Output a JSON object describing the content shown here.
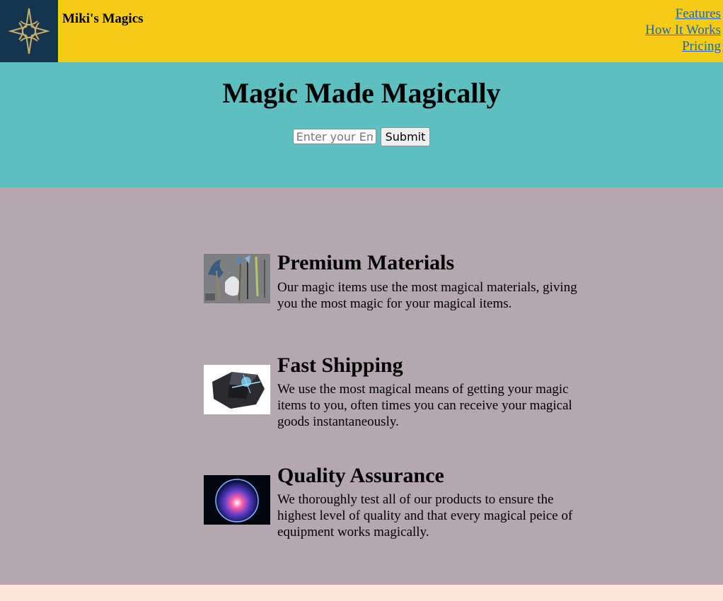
{
  "header": {
    "brand": "Miki's Magics",
    "nav": [
      "Features",
      "How It Works",
      "Pricing"
    ]
  },
  "hero": {
    "title": "Magic Made Magically",
    "email_placeholder": "Enter your Email",
    "submit_label": "Submit"
  },
  "features": [
    {
      "title": "Premium Materials",
      "text": "Our magic items use the most magical materials, giving you the most magic for your magical items."
    },
    {
      "title": "Fast Shipping",
      "text": "We use the most magical means of getting your magic items to you, often times you can receive your magical goods instantaneously."
    },
    {
      "title": "Quality Assurance",
      "text": "We thoroughly test all of our products to ensure the highest level of quality and that every magical peice of equipment works magically."
    }
  ],
  "colors": {
    "header_bg": "#f5cb16",
    "logo_bg": "#15354f",
    "hero_bg": "#5dbfbf",
    "features_bg": "#b4a7af",
    "footer_bg": "#fde6d8",
    "link": "#1e66b8"
  }
}
